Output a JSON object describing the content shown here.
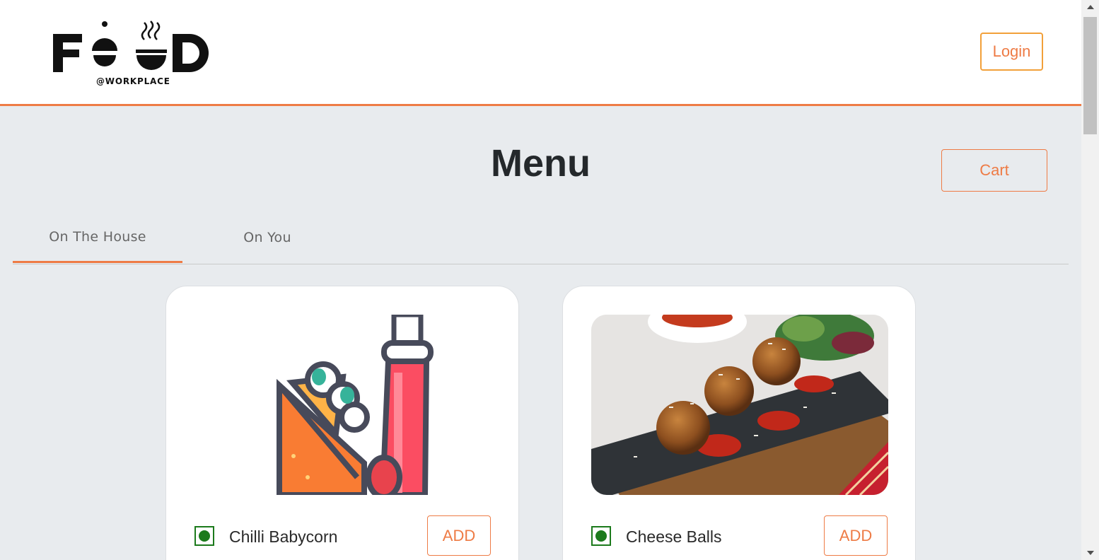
{
  "header": {
    "logo_text": "FOOD",
    "logo_subtext": "@WORKPLACE",
    "login_label": "Login"
  },
  "page": {
    "title": "Menu",
    "cart_label": "Cart"
  },
  "tabs": [
    {
      "label": "On The House",
      "active": true
    },
    {
      "label": "On You",
      "active": false
    }
  ],
  "items": [
    {
      "name": "Chilli Babycorn",
      "add_label": "ADD",
      "veg": true,
      "image": "wrap-and-ketchup-illustration"
    },
    {
      "name": "Cheese Balls",
      "add_label": "ADD",
      "veg": true,
      "image": "cheese-balls-photo"
    }
  ],
  "colors": {
    "accent": "#ee7b45",
    "login_border": "#f2a03a",
    "veg_green": "#1c7a1c",
    "page_bg": "#e8ebee"
  }
}
